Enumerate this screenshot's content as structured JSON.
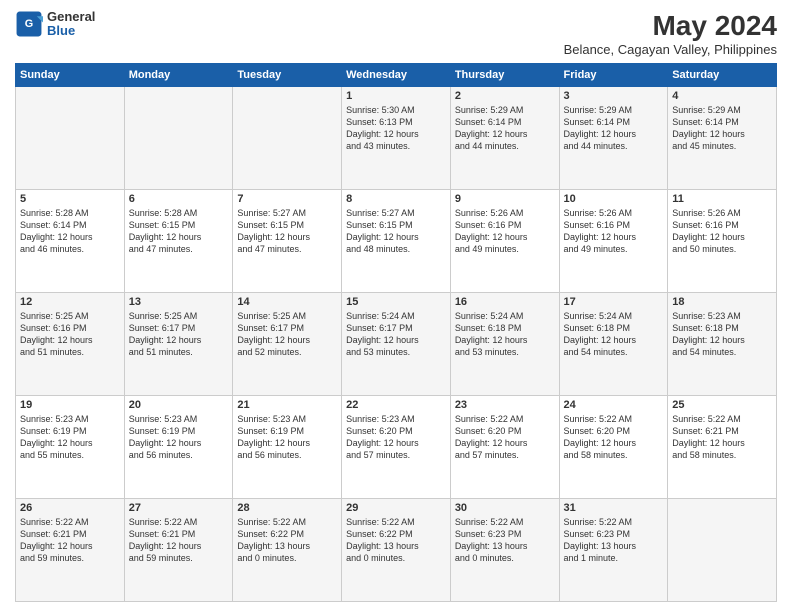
{
  "logo": {
    "general": "General",
    "blue": "Blue"
  },
  "title": "May 2024",
  "subtitle": "Belance, Cagayan Valley, Philippines",
  "headers": [
    "Sunday",
    "Monday",
    "Tuesday",
    "Wednesday",
    "Thursday",
    "Friday",
    "Saturday"
  ],
  "weeks": [
    [
      {
        "day": "",
        "info": ""
      },
      {
        "day": "",
        "info": ""
      },
      {
        "day": "",
        "info": ""
      },
      {
        "day": "1",
        "info": "Sunrise: 5:30 AM\nSunset: 6:13 PM\nDaylight: 12 hours\nand 43 minutes."
      },
      {
        "day": "2",
        "info": "Sunrise: 5:29 AM\nSunset: 6:14 PM\nDaylight: 12 hours\nand 44 minutes."
      },
      {
        "day": "3",
        "info": "Sunrise: 5:29 AM\nSunset: 6:14 PM\nDaylight: 12 hours\nand 44 minutes."
      },
      {
        "day": "4",
        "info": "Sunrise: 5:29 AM\nSunset: 6:14 PM\nDaylight: 12 hours\nand 45 minutes."
      }
    ],
    [
      {
        "day": "5",
        "info": "Sunrise: 5:28 AM\nSunset: 6:14 PM\nDaylight: 12 hours\nand 46 minutes."
      },
      {
        "day": "6",
        "info": "Sunrise: 5:28 AM\nSunset: 6:15 PM\nDaylight: 12 hours\nand 47 minutes."
      },
      {
        "day": "7",
        "info": "Sunrise: 5:27 AM\nSunset: 6:15 PM\nDaylight: 12 hours\nand 47 minutes."
      },
      {
        "day": "8",
        "info": "Sunrise: 5:27 AM\nSunset: 6:15 PM\nDaylight: 12 hours\nand 48 minutes."
      },
      {
        "day": "9",
        "info": "Sunrise: 5:26 AM\nSunset: 6:16 PM\nDaylight: 12 hours\nand 49 minutes."
      },
      {
        "day": "10",
        "info": "Sunrise: 5:26 AM\nSunset: 6:16 PM\nDaylight: 12 hours\nand 49 minutes."
      },
      {
        "day": "11",
        "info": "Sunrise: 5:26 AM\nSunset: 6:16 PM\nDaylight: 12 hours\nand 50 minutes."
      }
    ],
    [
      {
        "day": "12",
        "info": "Sunrise: 5:25 AM\nSunset: 6:16 PM\nDaylight: 12 hours\nand 51 minutes."
      },
      {
        "day": "13",
        "info": "Sunrise: 5:25 AM\nSunset: 6:17 PM\nDaylight: 12 hours\nand 51 minutes."
      },
      {
        "day": "14",
        "info": "Sunrise: 5:25 AM\nSunset: 6:17 PM\nDaylight: 12 hours\nand 52 minutes."
      },
      {
        "day": "15",
        "info": "Sunrise: 5:24 AM\nSunset: 6:17 PM\nDaylight: 12 hours\nand 53 minutes."
      },
      {
        "day": "16",
        "info": "Sunrise: 5:24 AM\nSunset: 6:18 PM\nDaylight: 12 hours\nand 53 minutes."
      },
      {
        "day": "17",
        "info": "Sunrise: 5:24 AM\nSunset: 6:18 PM\nDaylight: 12 hours\nand 54 minutes."
      },
      {
        "day": "18",
        "info": "Sunrise: 5:23 AM\nSunset: 6:18 PM\nDaylight: 12 hours\nand 54 minutes."
      }
    ],
    [
      {
        "day": "19",
        "info": "Sunrise: 5:23 AM\nSunset: 6:19 PM\nDaylight: 12 hours\nand 55 minutes."
      },
      {
        "day": "20",
        "info": "Sunrise: 5:23 AM\nSunset: 6:19 PM\nDaylight: 12 hours\nand 56 minutes."
      },
      {
        "day": "21",
        "info": "Sunrise: 5:23 AM\nSunset: 6:19 PM\nDaylight: 12 hours\nand 56 minutes."
      },
      {
        "day": "22",
        "info": "Sunrise: 5:23 AM\nSunset: 6:20 PM\nDaylight: 12 hours\nand 57 minutes."
      },
      {
        "day": "23",
        "info": "Sunrise: 5:22 AM\nSunset: 6:20 PM\nDaylight: 12 hours\nand 57 minutes."
      },
      {
        "day": "24",
        "info": "Sunrise: 5:22 AM\nSunset: 6:20 PM\nDaylight: 12 hours\nand 58 minutes."
      },
      {
        "day": "25",
        "info": "Sunrise: 5:22 AM\nSunset: 6:21 PM\nDaylight: 12 hours\nand 58 minutes."
      }
    ],
    [
      {
        "day": "26",
        "info": "Sunrise: 5:22 AM\nSunset: 6:21 PM\nDaylight: 12 hours\nand 59 minutes."
      },
      {
        "day": "27",
        "info": "Sunrise: 5:22 AM\nSunset: 6:21 PM\nDaylight: 12 hours\nand 59 minutes."
      },
      {
        "day": "28",
        "info": "Sunrise: 5:22 AM\nSunset: 6:22 PM\nDaylight: 13 hours\nand 0 minutes."
      },
      {
        "day": "29",
        "info": "Sunrise: 5:22 AM\nSunset: 6:22 PM\nDaylight: 13 hours\nand 0 minutes."
      },
      {
        "day": "30",
        "info": "Sunrise: 5:22 AM\nSunset: 6:23 PM\nDaylight: 13 hours\nand 0 minutes."
      },
      {
        "day": "31",
        "info": "Sunrise: 5:22 AM\nSunset: 6:23 PM\nDaylight: 13 hours\nand 1 minute."
      },
      {
        "day": "",
        "info": ""
      }
    ]
  ]
}
